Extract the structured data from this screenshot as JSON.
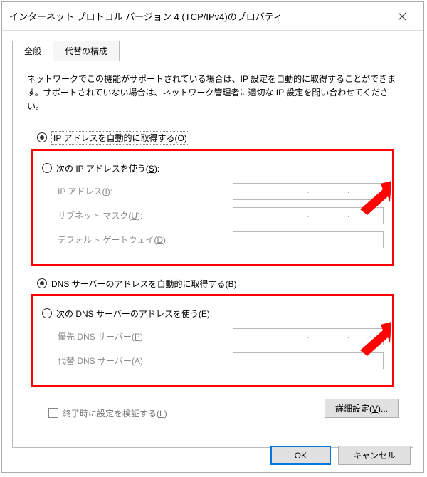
{
  "titlebar": {
    "title": "インターネット プロトコル バージョン 4 (TCP/IPv4)のプロパティ"
  },
  "tabs": {
    "general": "全般",
    "alternate": "代替の構成"
  },
  "intro": "ネットワークでこの機能がサポートされている場合は、IP 設定を自動的に取得することができます。サポートされていない場合は、ネットワーク管理者に適切な IP 設定を問い合わせてください。",
  "ip": {
    "auto_label": "IP アドレスを自動的に取得する(",
    "auto_key": "O",
    "auto_close": ")",
    "manual_label": "次の IP アドレスを使う(",
    "manual_key": "S",
    "manual_close": "):",
    "addr_label": "IP アドレス(",
    "addr_key": "I",
    "addr_close": "):",
    "mask_label": "サブネット マスク(",
    "mask_key": "U",
    "mask_close": "):",
    "gw_label": "デフォルト ゲートウェイ(",
    "gw_key": "D",
    "gw_close": "):"
  },
  "dns": {
    "auto_label": "DNS サーバーのアドレスを自動的に取得する(",
    "auto_key": "B",
    "auto_close": ")",
    "manual_label": "次の DNS サーバーのアドレスを使う(",
    "manual_key": "E",
    "manual_close": "):",
    "pref_label": "優先 DNS サーバー(",
    "pref_key": "P",
    "pref_close": "):",
    "alt_label": "代替 DNS サーバー(",
    "alt_key": "A",
    "alt_close": "):"
  },
  "validate_label": "終了時に設定を検証する(",
  "validate_key": "L",
  "validate_close": ")",
  "advanced_label": "詳細設定(",
  "advanced_key": "V",
  "advanced_close": ")...",
  "buttons": {
    "ok": "OK",
    "cancel": "キャンセル"
  }
}
